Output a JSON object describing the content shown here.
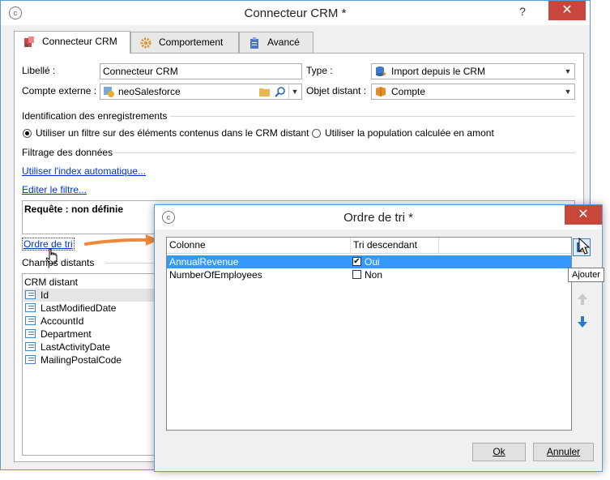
{
  "main_window": {
    "title": "Connecteur CRM *",
    "tabs": [
      {
        "label": "Connecteur CRM",
        "icon": "crm-connector-icon"
      },
      {
        "label": "Comportement",
        "icon": "gear-icon"
      },
      {
        "label": "Avancé",
        "icon": "clipboard-icon"
      }
    ],
    "libelle_label": "Libellé :",
    "libelle_value": "Connecteur CRM",
    "type_label": "Type :",
    "type_value": "Import depuis le CRM",
    "compte_label": "Compte externe :",
    "compte_value": "neoSalesforce",
    "objet_label": "Objet distant :",
    "objet_value": "Compte",
    "identification_title": "Identification des enregistrements",
    "radio_filter": "Utiliser un filtre sur des éléments contenus dans le CRM distant",
    "radio_population": "Utiliser la population calculée en amont",
    "filtrage_title": "Filtrage des données",
    "link_index": "Utiliser l'index automatique...",
    "link_filter": "Editer le filtre...",
    "requete_text": "Requête : non définie",
    "link_sort": "Ordre de tri",
    "champs_title": "Champs distants",
    "crm_column": "CRM distant",
    "crm_fields": [
      "Id",
      "LastModifiedDate",
      "AccountId",
      "Department",
      "LastActivityDate",
      "MailingPostalCode"
    ]
  },
  "sort_dialog": {
    "title": "Ordre de tri *",
    "col_colonne": "Colonne",
    "col_tri": "Tri descendant",
    "rows": [
      {
        "column": "AnnualRevenue",
        "checked": true,
        "value": "Oui"
      },
      {
        "column": "NumberOfEmployees",
        "checked": false,
        "value": "Non"
      }
    ],
    "tooltip": "Ajouter",
    "ok_label": "Ok",
    "cancel_label": "Annuler"
  },
  "colors": {
    "selection": "#3399ff",
    "close_button": "#c7483a",
    "link": "#0033cc",
    "callout_arrow": "#f0883a"
  }
}
